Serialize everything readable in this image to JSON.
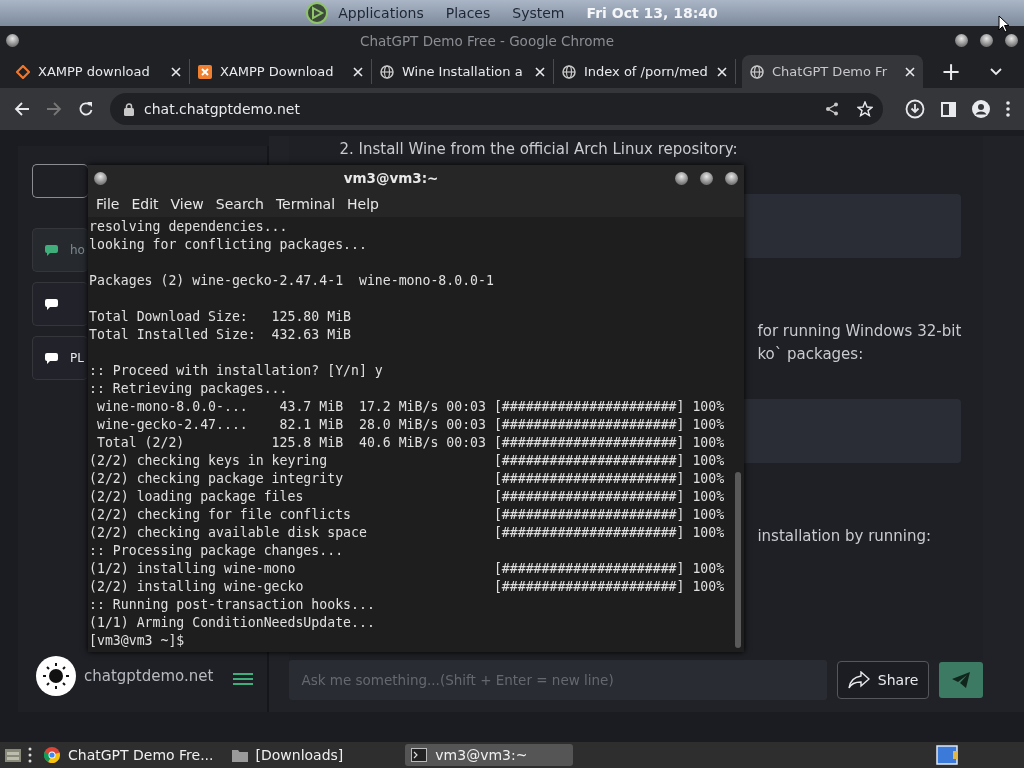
{
  "top_panel": {
    "menus": [
      "Applications",
      "Places",
      "System"
    ],
    "clock": "Fri Oct 13, 18:40"
  },
  "browser": {
    "title": "ChatGPT Demo Free - Google Chrome",
    "tabs": [
      {
        "label": "XAMPP download",
        "kind": "diamond",
        "selected": false
      },
      {
        "label": "XAMPP Download",
        "kind": "xampp",
        "selected": false
      },
      {
        "label": "Wine Installation a",
        "kind": "globe",
        "selected": false
      },
      {
        "label": "Index of /porn/med",
        "kind": "globe",
        "selected": false
      },
      {
        "label": "ChatGPT Demo Fr",
        "kind": "globe",
        "selected": true
      }
    ],
    "new_tab": "+",
    "url": "chat.chatgptdemo.net"
  },
  "page": {
    "chats": [
      {
        "label": "ho",
        "selected": true
      },
      {
        "selected": false
      },
      {
        "label": "PL",
        "selected": false
      }
    ],
    "brand": "chatgptdemo.net",
    "content": [
      {
        "kind": "text",
        "text": "2. Install Wine from the official Arch Linux repository:"
      },
      {
        "kind": "code"
      },
      {
        "kind": "tail",
        "lines": [
          "for running Windows 32-bit",
          "ko` packages:"
        ]
      },
      {
        "kind": "code"
      },
      {
        "kind": "tail",
        "lines": [
          "installation by running:"
        ]
      }
    ],
    "input_placeholder": "Ask me something...(Shift + Enter = new line)",
    "share": "Share"
  },
  "terminal": {
    "title": "vm3@vm3:~",
    "menu": [
      "File",
      "Edit",
      "View",
      "Search",
      "Terminal",
      "Help"
    ],
    "paragraphs": [
      [
        "resolving dependencies...",
        "looking for conflicting packages..."
      ],
      [
        "Packages (2) wine-gecko-2.47.4-1  wine-mono-8.0.0-1"
      ],
      [
        "Total Download Size:   125.80 MiB",
        "Total Installed Size:  432.63 MiB"
      ],
      [
        ":: Proceed with installation? [Y/n] y",
        ":: Retrieving packages...",
        " wine-mono-8.0.0-...    43.7 MiB  17.2 MiB/s 00:03 [######################] 100%",
        " wine-gecko-2.47....    82.1 MiB  28.0 MiB/s 00:03 [######################] 100%",
        " Total (2/2)           125.8 MiB  40.6 MiB/s 00:03 [######################] 100%",
        "(2/2) checking keys in keyring                     [######################] 100%",
        "(2/2) checking package integrity                   [######################] 100%",
        "(2/2) loading package files                        [######################] 100%",
        "(2/2) checking for file conflicts                  [######################] 100%",
        "(2/2) checking available disk space                [######################] 100%",
        ":: Processing package changes...",
        "(1/2) installing wine-mono                         [######################] 100%",
        "(2/2) installing wine-gecko                        [######################] 100%",
        ":: Running post-transaction hooks...",
        "(1/1) Arming ConditionNeedsUpdate...",
        "[vm3@vm3 ~]$"
      ]
    ]
  },
  "taskbar": {
    "items": [
      {
        "label": "ChatGPT Demo Fre...",
        "kind": "chrome",
        "selected": false
      },
      {
        "label": "[Downloads]",
        "kind": "folder",
        "selected": false
      },
      {
        "label": "vm3@vm3:~",
        "kind": "terminal",
        "selected": true
      }
    ]
  }
}
